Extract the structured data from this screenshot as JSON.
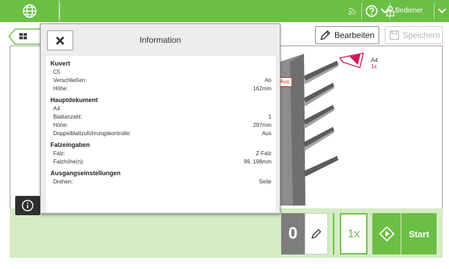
{
  "topbar": {
    "home_icon": "globe-icon",
    "wifi_icon": "wifi-icon",
    "help_icon": "question-icon",
    "user_icon": "user-icon",
    "user_label": "Bediener",
    "bar_color": "#6cbf45"
  },
  "toolbar": {
    "edit_label": "Bearbeiten",
    "save_label": "Speichern"
  },
  "machine": {
    "aus_badge": "Aus",
    "a4_label": "A4",
    "a4_count": "1x"
  },
  "dialog": {
    "title": "Information",
    "sections": [
      {
        "title": "Kuvert",
        "rows": [
          {
            "label": "C5",
            "value": ""
          },
          {
            "label": "Verschließen:",
            "value": "An"
          },
          {
            "label": "Höhe:",
            "value": "162mm"
          }
        ]
      },
      {
        "title": "Hauptdokument",
        "rows": [
          {
            "label": "A4",
            "value": ""
          },
          {
            "label": "Blattanzahl:",
            "value": "1"
          },
          {
            "label": "Höhe:",
            "value": "297mm"
          },
          {
            "label": "Doppelblattzuführungskontrolle:",
            "value": "Aus"
          }
        ]
      },
      {
        "title": "Falzeingaben",
        "rows": [
          {
            "label": "Falz:",
            "value": "Z-Falz"
          },
          {
            "label": "Falzhöhe(n):",
            "value": "99, 198mm"
          }
        ]
      },
      {
        "title": "Ausgangseinstellungen",
        "rows": [
          {
            "label": "Drehen:",
            "value": "Seite"
          }
        ]
      }
    ]
  },
  "bottom": {
    "counter": "0",
    "multiplier": "1x",
    "start_label": "Start",
    "accent": "#6cbf45"
  }
}
